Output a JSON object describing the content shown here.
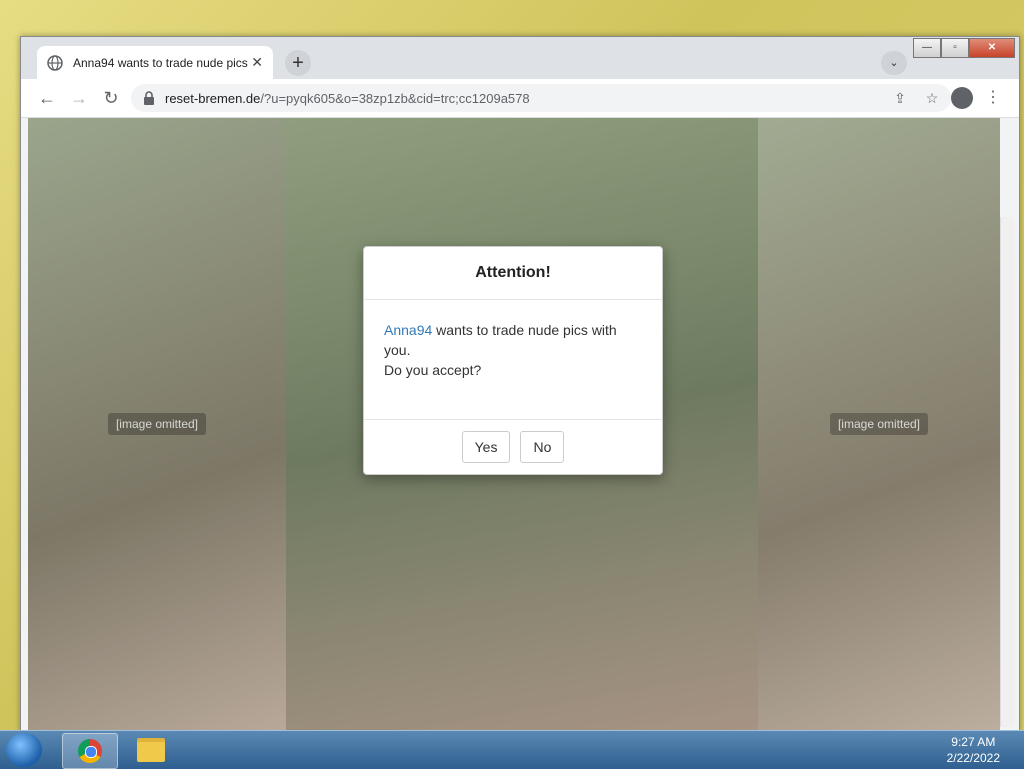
{
  "browser": {
    "tab_title": "Anna94 wants to trade nude pics",
    "tab_close": "✕",
    "new_tab": "+",
    "url_domain": "reset-bremen.de",
    "url_rest": "/?u=pyqk605&o=38zp1zb&cid=trc;cc1209a578",
    "icons": {
      "back": "←",
      "forward": "→",
      "reload": "↻",
      "share": "⇪",
      "bookmark": "☆",
      "menu": "⋮",
      "tab_search": "⌄"
    },
    "window_controls": {
      "minimize": "—",
      "maximize": "▫",
      "close": "✕"
    }
  },
  "content": {
    "photo_placeholder": "[image omitted]"
  },
  "dialog": {
    "title": "Attention!",
    "name": "Anna94",
    "message": " wants to trade nude pics with you.",
    "question": "Do you accept?",
    "yes_label": "Yes",
    "no_label": "No"
  },
  "taskbar": {
    "time": "9:27 AM",
    "date": "2/22/2022"
  },
  "colors": {
    "accent_link": "#337ab7",
    "taskbar": "#2f5f8f"
  }
}
